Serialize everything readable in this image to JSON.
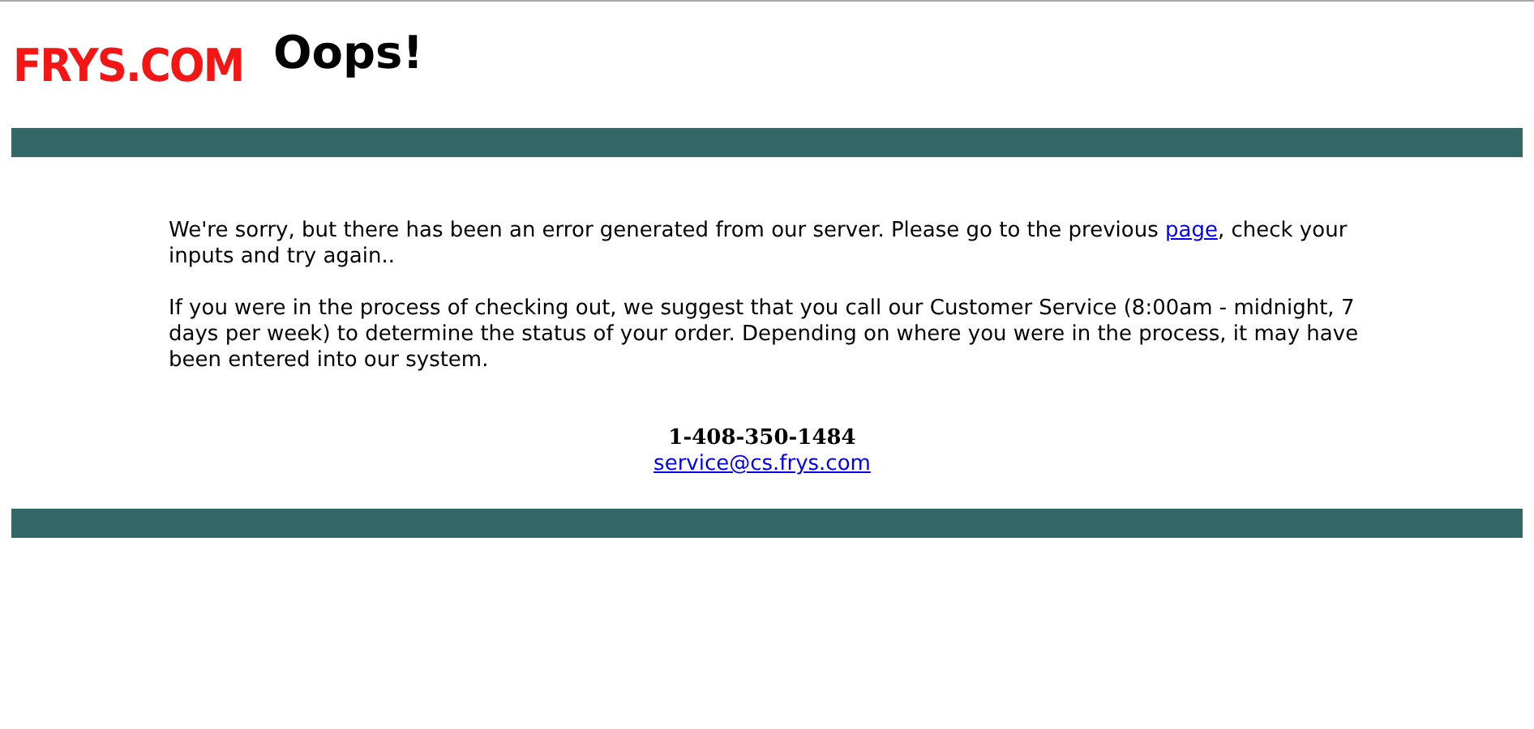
{
  "header": {
    "logo": "FRYS.COM",
    "title": "Oops!"
  },
  "message": {
    "paragraph_1": {
      "before_link": "We're sorry, but there has been an error generated from our server. Please go to the previous ",
      "link": "page",
      "after_link": ", check your inputs and try again.."
    },
    "paragraph_2": "If you were in the process of checking out, we suggest that you call our Customer Service (8:00am - midnight, 7 days per week) to determine the status of your order. Depending on where you were in the process, it may have been entered into our system."
  },
  "contact": {
    "phone": "1-408-350-1484",
    "email": "service@cs.frys.com"
  }
}
